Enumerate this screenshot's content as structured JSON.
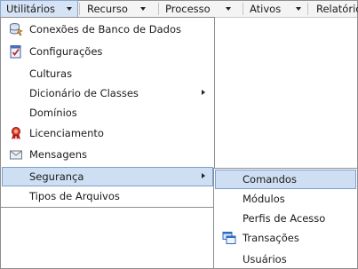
{
  "menubar": {
    "items": [
      {
        "label": "Utilitários"
      },
      {
        "label": "Recurso"
      },
      {
        "label": "Processo"
      },
      {
        "label": "Ativos"
      },
      {
        "label": "Relatórios"
      }
    ]
  },
  "utilitarios_menu": {
    "items": [
      {
        "label": "Conexões de Banco de Dados",
        "icon": "database-connection-icon"
      },
      {
        "label": "Configurações",
        "icon": "checklist-icon"
      },
      {
        "label": "Culturas"
      },
      {
        "label": "Dicionário de Classes"
      },
      {
        "label": "Domínios"
      },
      {
        "label": "Licenciamento",
        "icon": "award-ribbon-icon"
      },
      {
        "label": "Mensagens",
        "icon": "envelope-icon"
      },
      {
        "label": "Segurança"
      },
      {
        "label": "Tipos de Arquivos"
      }
    ]
  },
  "seguranca_submenu": {
    "items": [
      {
        "label": "Comandos"
      },
      {
        "label": "Módulos"
      },
      {
        "label": "Perfis de Acesso"
      },
      {
        "label": "Transações",
        "icon": "windows-stack-icon"
      },
      {
        "label": "Usuários"
      }
    ]
  },
  "colors": {
    "highlight_bg": "#cfdff3",
    "highlight_border": "#7e9fcf",
    "menubar_bg": "#f4f4f4"
  }
}
